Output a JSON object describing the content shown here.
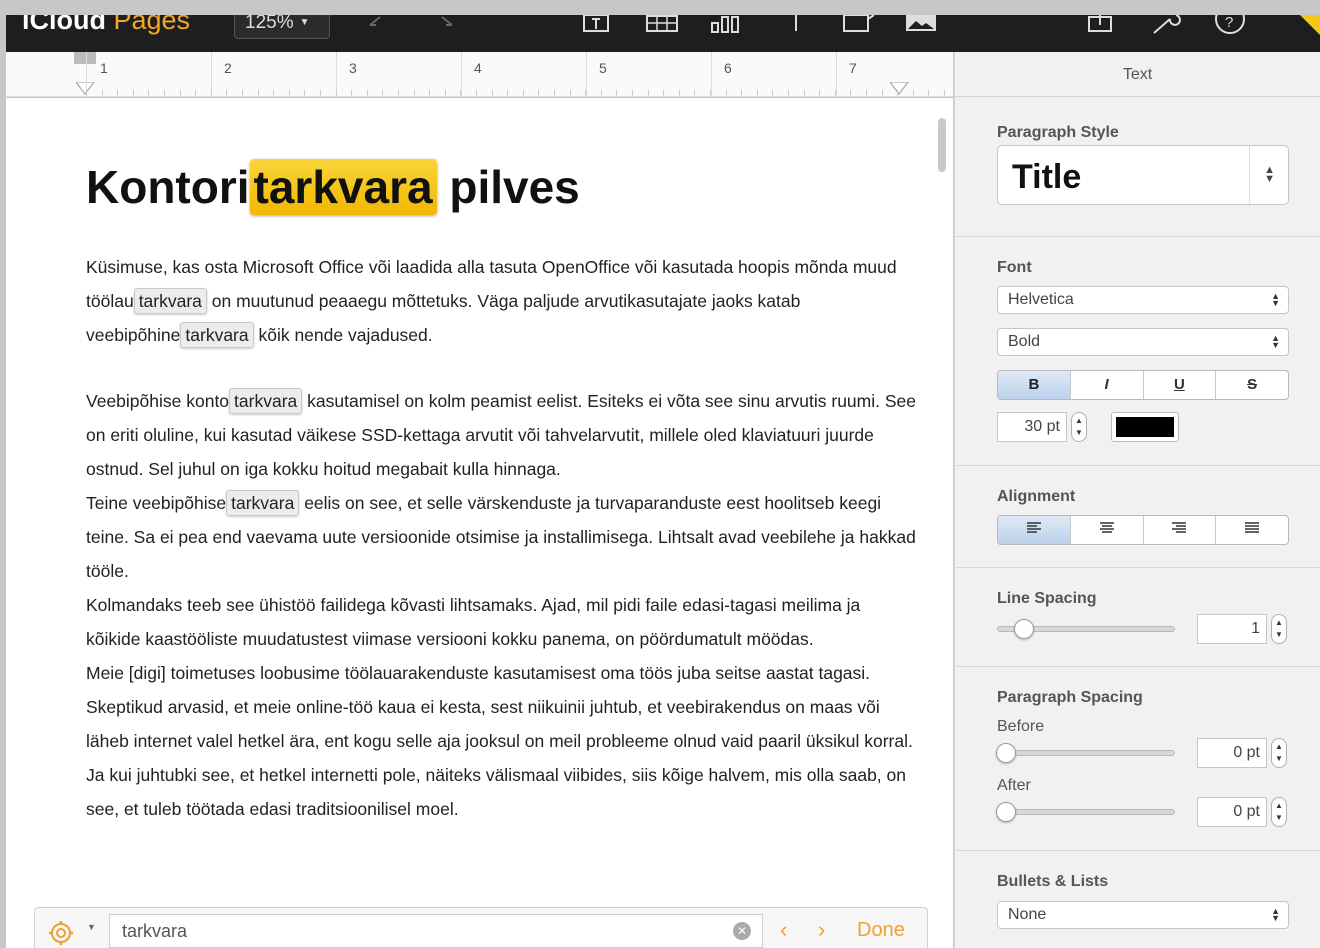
{
  "app": {
    "brand_left": "iCloud",
    "brand_right": "Pages",
    "zoom": "125%"
  },
  "toolbar_icons": [
    "undo-icon",
    "redo-icon",
    "text-box-icon",
    "table-icon",
    "chart-icon",
    "shape-line-icon",
    "shape-icon",
    "image-icon",
    "share-icon",
    "tools-icon",
    "help-icon"
  ],
  "ruler": {
    "numbers": [
      "1",
      "2",
      "3",
      "4",
      "5",
      "6",
      "7"
    ]
  },
  "document": {
    "title_before": "Kontori",
    "title_highlight": "tarkvara",
    "title_after": " pilves",
    "p1": {
      "a": "Küsimuse, kas osta Microsoft Office või laadida alla tasuta OpenOffice või kasutada hoopis mõnda muud töölau",
      "hl1": "tarkvara",
      "b": " on muutunud peaaegu mõttetuks. Väga paljude arvutikasutajate jaoks katab veebipõhine",
      "hl2": "tarkvara",
      "c": " kõik nende vajadused."
    },
    "p2": {
      "a": "Veebipõhise konto",
      "hl": "tarkvara",
      "b": " kasutamisel on kolm peamist eelist. Esiteks ei võta see sinu arvutis ruumi. See on eriti oluline, kui kasutad väikese SSD-kettaga arvutit või tahvelarvutit, millele oled klaviatuuri juurde ostnud. Sel juhul on iga kokku hoitud megabait kulla hinnaga."
    },
    "p3": {
      "a": "Teine veebipõhise",
      "hl": "tarkvara",
      "b": " eelis on see, et selle värskenduste ja turvaparanduste eest hoolitseb keegi teine. Sa ei pea end vaevama uute versioonide otsimise ja installimisega. Lihtsalt avad veebilehe ja hakkad tööle."
    },
    "p4": "Kolmandaks teeb see ühistöö failidega kõvasti lihtsamaks. Ajad, mil pidi faile edasi-tagasi meilima ja kõikide kaastööliste muudatustest viimase versiooni kokku panema, on pöördumatult möödas.",
    "p5": "Meie [digi] toimetuses loobusime töölauarakenduste kasutamisest oma töös juba seitse aastat tagasi. Skeptikud arvasid, et meie online-töö kaua ei kesta, sest niikuinii juhtub, et veebirakendus on maas või läheb internet valel hetkel ära, ent kogu selle aja jooksul on meil probleeme olnud vaid paaril üksikul korral. Ja kui juhtubki see, et hetkel internetti pole, näiteks välismaal viibides, siis kõige halvem, mis olla saab, on see, et tuleb töötada edasi traditsioonilisel moel."
  },
  "findbar": {
    "value": "tarkvara",
    "prev": "‹",
    "next": "›",
    "done": "Done"
  },
  "panel": {
    "tab": "Text",
    "paragraph_style": {
      "label": "Paragraph Style",
      "value": "Title"
    },
    "font": {
      "label": "Font",
      "family": "Helvetica",
      "weight": "Bold",
      "buttons": [
        "B",
        "I",
        "U",
        "S"
      ],
      "size": "30 pt",
      "color": "#000000"
    },
    "alignment": {
      "label": "Alignment",
      "selected": "left"
    },
    "line_spacing": {
      "label": "Line Spacing",
      "value": "1"
    },
    "paragraph_spacing": {
      "label": "Paragraph Spacing",
      "before_label": "Before",
      "before": "0 pt",
      "after_label": "After",
      "after": "0 pt"
    },
    "bullets": {
      "label": "Bullets & Lists",
      "value": "None"
    }
  },
  "colors": {
    "accent": "#f0a030",
    "highlight": "#f5c518",
    "toolbar": "#1e1e1e"
  }
}
